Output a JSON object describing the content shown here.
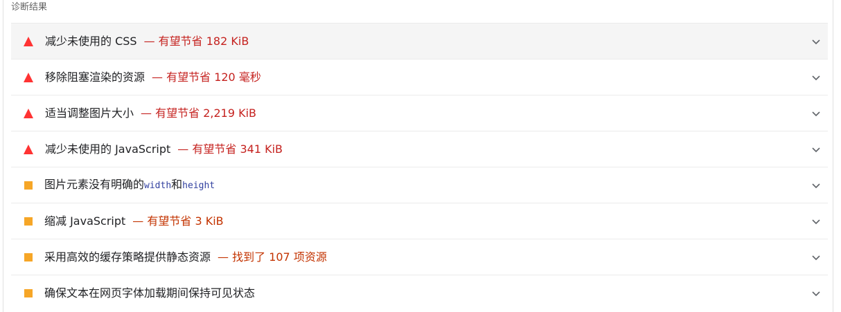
{
  "section_title": "诊断结果",
  "audits": [
    {
      "severity": "fail",
      "title": "减少未使用的 CSS",
      "savings": "— 有望节省 182 KiB"
    },
    {
      "severity": "fail",
      "title": "移除阻塞渲染的资源",
      "savings": "— 有望节省 120 毫秒"
    },
    {
      "severity": "fail",
      "title": "适当调整图片大小",
      "savings": "— 有望节省 2,219 KiB"
    },
    {
      "severity": "fail",
      "title": "减少未使用的 JavaScript",
      "savings": "— 有望节省 341 KiB"
    },
    {
      "severity": "average",
      "title_parts": [
        "图片元素没有明确的",
        "width",
        "和",
        "height"
      ]
    },
    {
      "severity": "average",
      "title": "缩减 JavaScript",
      "savings": "— 有望节省 3 KiB"
    },
    {
      "severity": "average",
      "title": "采用高效的缓存策略提供静态资源",
      "savings": "— 找到了 107 项资源"
    },
    {
      "severity": "average",
      "title": "确保文本在网页字体加载期间保持可见状态"
    }
  ],
  "colors": {
    "fail": "#f33",
    "average": "#f6a627",
    "fail_text": "#c5221f",
    "average_text": "#c33300"
  }
}
